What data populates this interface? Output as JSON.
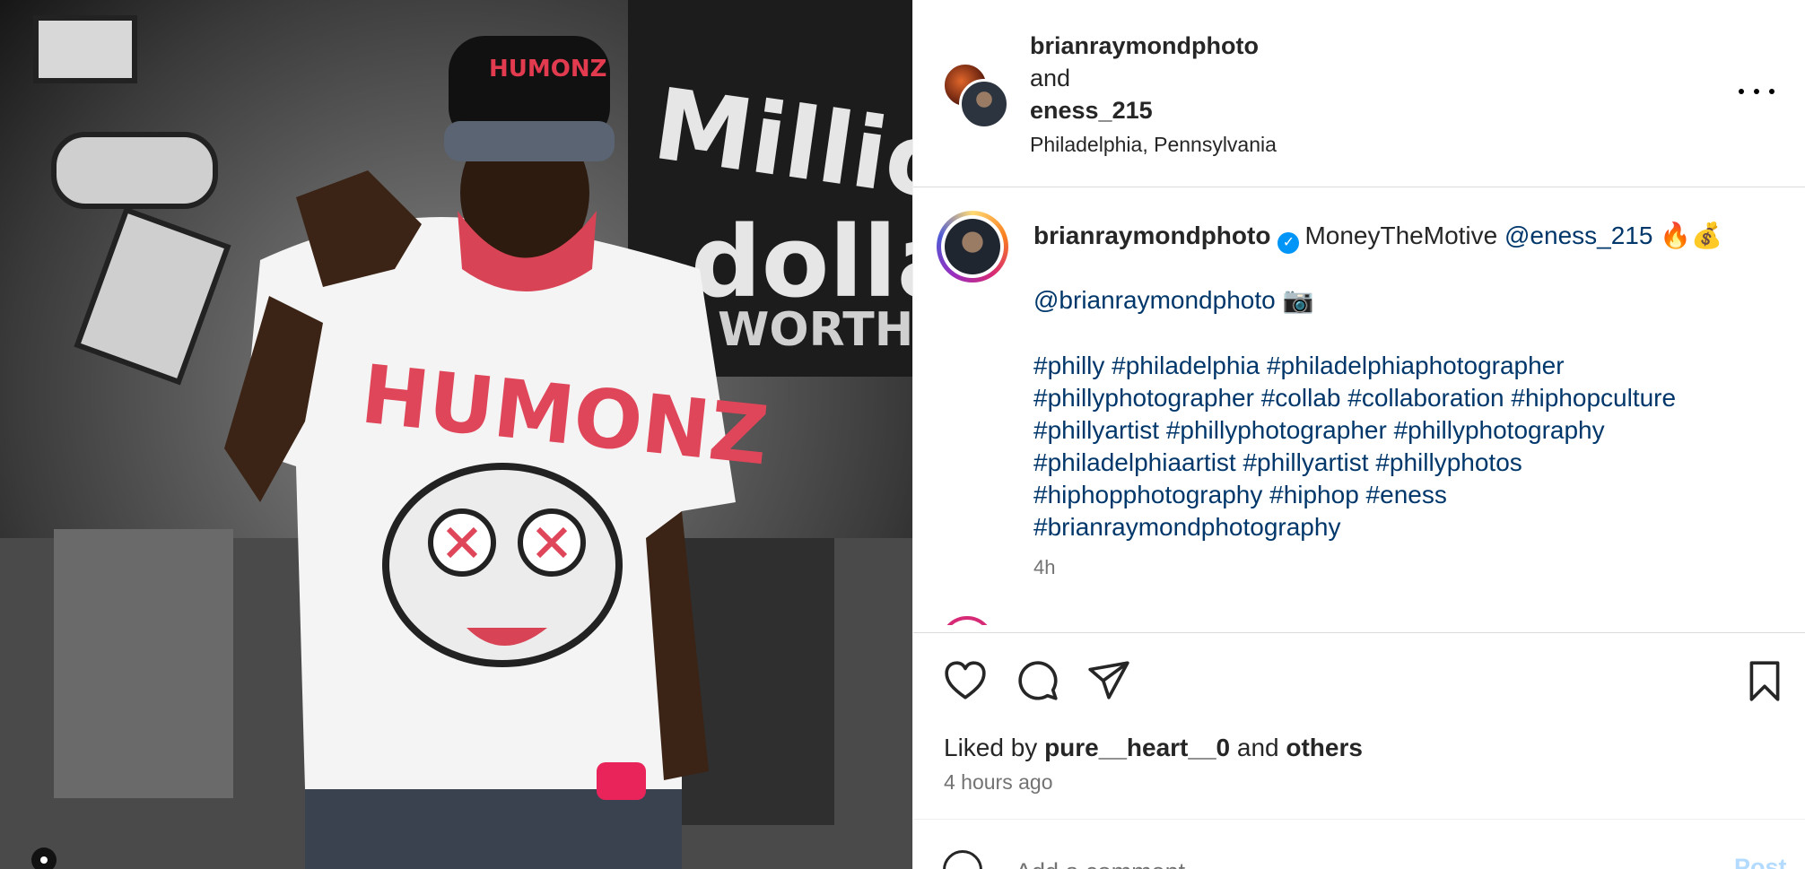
{
  "header": {
    "user1": "brianraymondphoto",
    "and_text": " and",
    "user2": "eness_215",
    "location": "Philadelphia, Pennsylvania"
  },
  "caption": {
    "username": "brianraymondphoto",
    "text": "MoneyTheMotive",
    "mention": "@eness_215",
    "emojis": "🔥💰",
    "credit_mention": "@brianraymondphoto",
    "camera_emoji": "📷",
    "hashtag_lines": [
      "#philly #philadelphia #philadelphiaphotographer",
      "#phillyphotographer #collab #collaboration #hiphopculture",
      "#phillyartist #phillyphotographer #phillyphotography",
      "#philadelphiaartist #phillyartist #phillyphotos",
      "#hiphopphotography #hiphop #eness",
      "#brianraymondphotography"
    ],
    "time": "4h"
  },
  "actions": {
    "liked_by_prefix": "Liked by ",
    "liked_by_user": "pure__heart__0",
    "liked_by_mid": " and ",
    "liked_by_others": "others",
    "time_ago": "4 hours ago"
  },
  "comment": {
    "placeholder": "Add a comment…",
    "post_label": "Post"
  },
  "icons": [
    "more-icon",
    "verified-icon",
    "like-icon",
    "comment-icon",
    "share-icon",
    "save-icon",
    "emoji-icon"
  ],
  "colors": {
    "link": "#00376b",
    "verified": "#0095f6",
    "post_disabled": "#b3dbff",
    "muted": "#737373"
  }
}
